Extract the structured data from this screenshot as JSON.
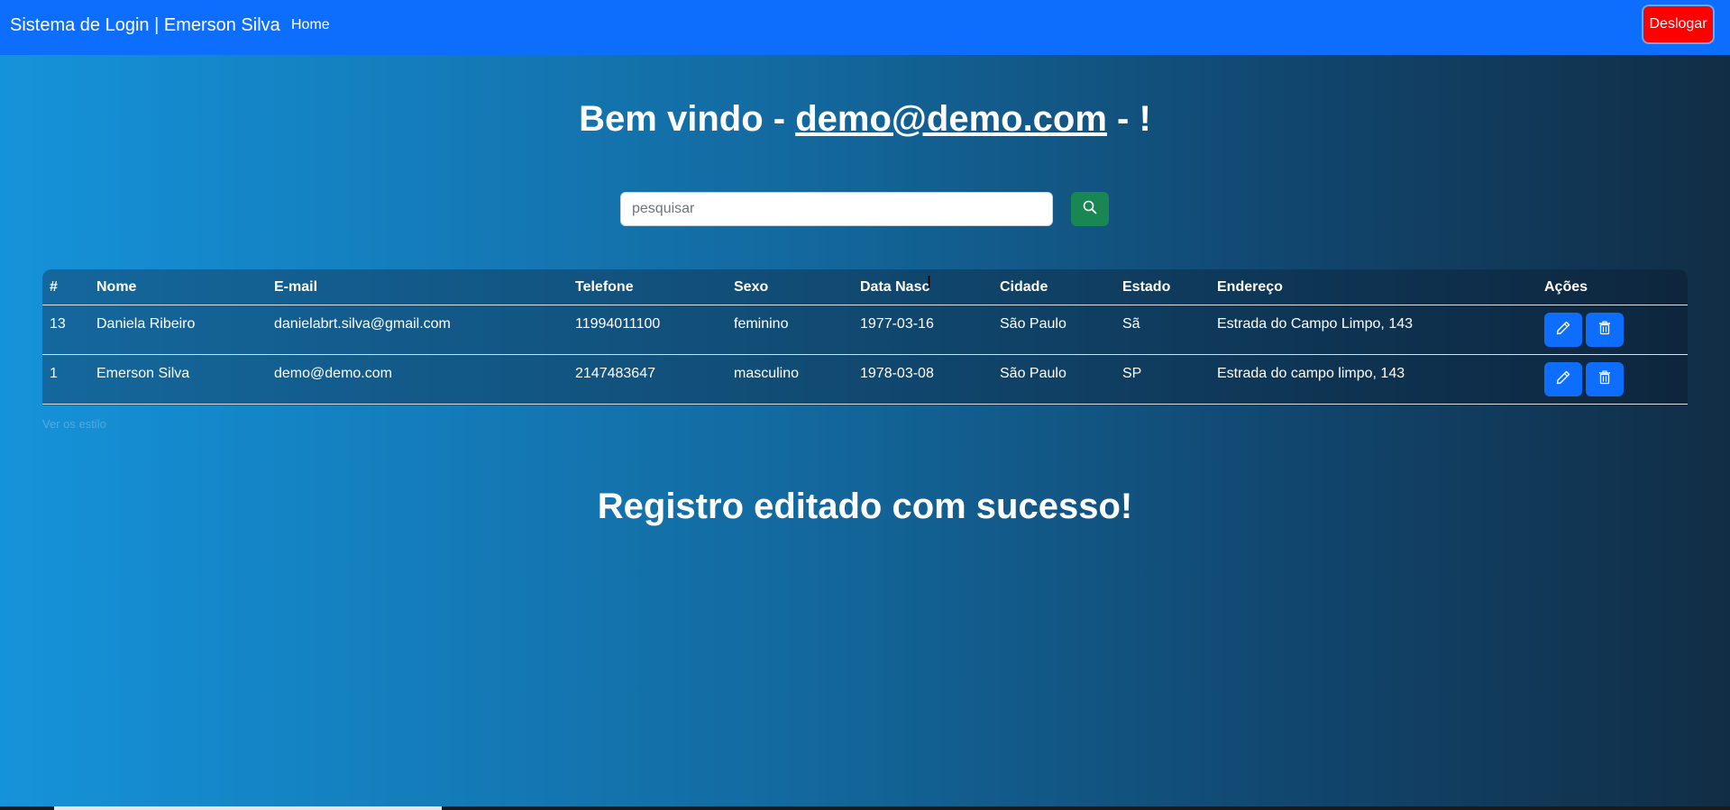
{
  "navbar": {
    "brand": "Sistema de Login | Emerson Silva",
    "home": "Home",
    "logout": "Deslogar",
    "color": "#0d6efd",
    "logout_color": "#ff0000"
  },
  "welcome": {
    "prefix": "Bem vindo - ",
    "email": "demo@demo.com",
    "suffix": " - !"
  },
  "search": {
    "placeholder": "pesquisar",
    "value": "",
    "button_icon": "search-icon",
    "button_color": "#198754"
  },
  "table": {
    "headers": [
      "#",
      "Nome",
      "E-mail",
      "Telefone",
      "Sexo",
      "Data Nasc",
      "Cidade",
      "Estado",
      "Endereço",
      "Ações"
    ],
    "rows": [
      {
        "id": "13",
        "nome": "Daniela Ribeiro",
        "email": "danielabrt.silva@gmail.com",
        "telefone": "11994011100",
        "sexo": "feminino",
        "data_nasc": "1977-03-16",
        "cidade": "São Paulo",
        "estado": "Sã",
        "endereco": "Estrada do Campo Limpo, 143"
      },
      {
        "id": "1",
        "nome": "Emerson Silva",
        "email": "demo@demo.com",
        "telefone": "2147483647",
        "sexo": "masculino",
        "data_nasc": "1978-03-08",
        "cidade": "São Paulo",
        "estado": "SP",
        "endereco": "Estrada do campo limpo, 143"
      }
    ],
    "action_icons": [
      "pencil-icon",
      "trash-icon"
    ],
    "action_color": "#0d6efd"
  },
  "footnote": "Ver os estilo",
  "message": "Registro editado com sucesso!"
}
